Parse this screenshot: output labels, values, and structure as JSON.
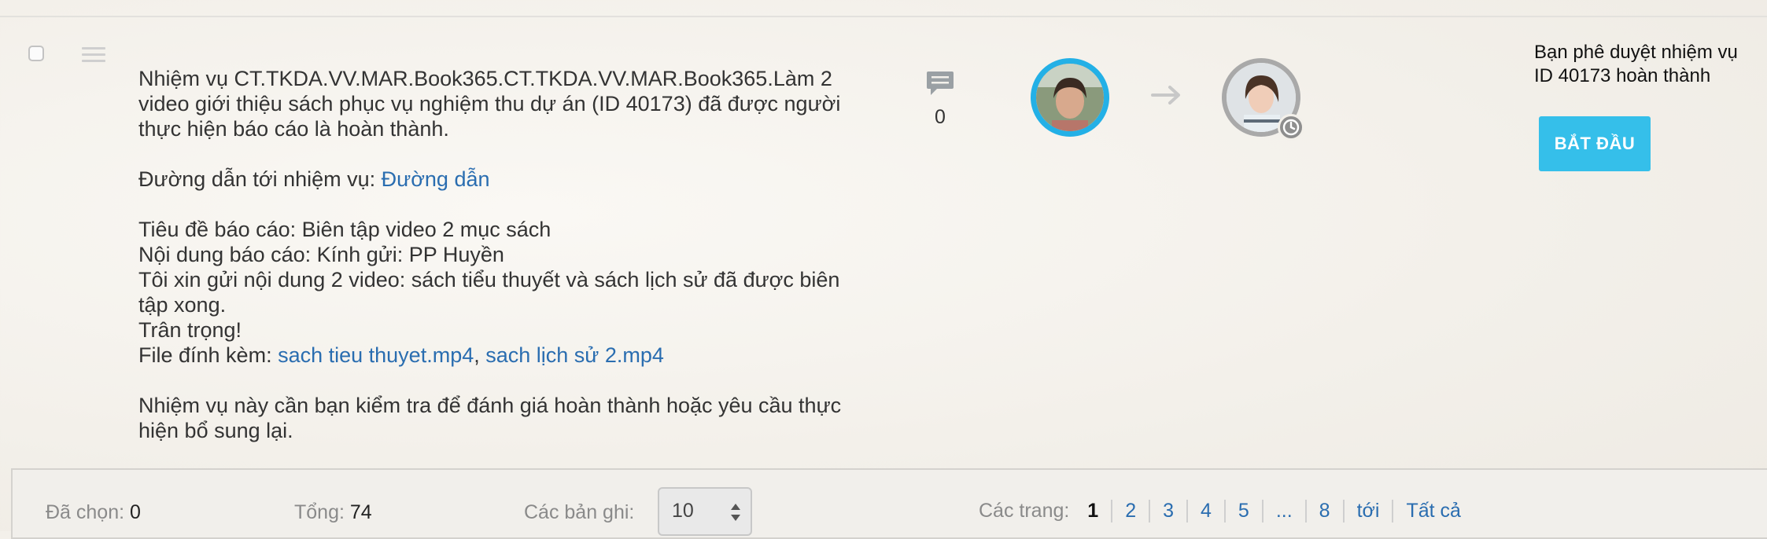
{
  "task": {
    "message_lines": [
      "Nhiệm vụ CT.TKDA.VV.MAR.Book365.CT.TKDA.VV.MAR.Book365.Làm 2",
      "video giới thiệu sách phục vụ nghiệm thu dự án (ID 40173) đã được người",
      "thực hiện báo cáo là hoàn thành."
    ],
    "link_prefix": "Đường dẫn tới nhiệm vụ: ",
    "link_text": "Đường dẫn",
    "report_title": "Tiêu đề báo cáo: Biên tập video 2 mục sách",
    "report_content": "Nội dung báo cáo: Kính gửi: PP Huyền",
    "report_body_1": "Tôi xin gửi nội dung 2 video: sách tiểu thuyết và sách lịch sử đã được biên",
    "report_body_2": "tập xong.",
    "report_closing": "Trân trọng!",
    "attachment_prefix": "File đính kèm: ",
    "attachment_1": "sach tieu thuyet.mp4",
    "attachment_sep": ", ",
    "attachment_2": "sach lịch sử 2.mp4",
    "review_1": "Nhiệm vụ này cần bạn kiểm tra để đánh giá hoàn thành hoặc yêu cầu thực",
    "review_2": "hiện bổ sung lại.",
    "comment_count": "0",
    "status_line_1": "Bạn phê duyệt nhiệm vụ",
    "status_line_2": "ID 40173 hoàn thành",
    "start_button": "BẮT ĐẦU"
  },
  "footer": {
    "selected_label": "Đã chọn: ",
    "selected_value": "0",
    "total_label": "Tổng: ",
    "total_value": "74",
    "records_label": "Các bản ghi: ",
    "records_value": "10",
    "pages_label": "Các trang: ",
    "pages": [
      "1",
      "2",
      "3",
      "4",
      "5",
      "...",
      "8",
      "tới",
      "Tất cả"
    ],
    "current_page": "1"
  },
  "colors": {
    "accent": "#35bfea",
    "link": "#2a6db0",
    "avatar_ring_from": "#23b0e6",
    "avatar_ring_to": "#a9a9a9"
  }
}
